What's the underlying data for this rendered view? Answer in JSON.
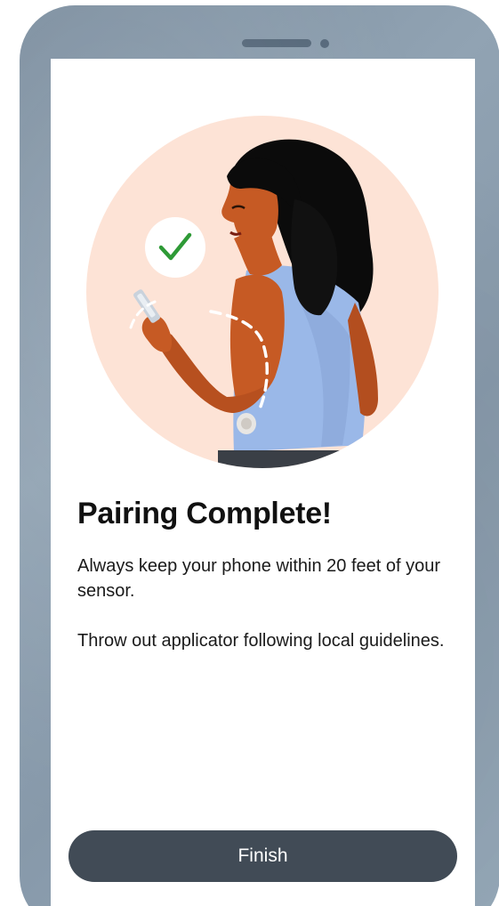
{
  "screen": {
    "title": "Pairing Complete!",
    "paragraphs": [
      "Always keep your phone within 20 feet of your sensor.",
      "Throw out applicator following local guidelines."
    ],
    "finish_button_label": "Finish"
  },
  "illustration": {
    "subject": "woman-checking-phone-with-arm-sensor",
    "icons": [
      "check-icon",
      "sensor-icon",
      "phone-icon"
    ]
  },
  "colors": {
    "circle_background": "#fde3d6",
    "check_mark": "#2e9a36",
    "button_background": "#414b56",
    "button_text": "#ffffff",
    "frame": "#8a9cad",
    "tank_top": "#9ab8e8",
    "skin": "#c65a24",
    "hair": "#0b0b0b"
  }
}
